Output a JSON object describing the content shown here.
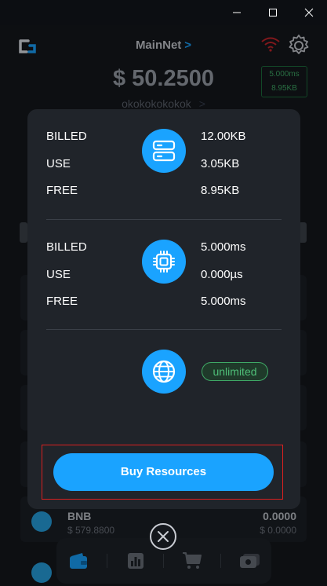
{
  "window": {
    "minimize_glyph": "—",
    "maximize_glyph": "☐",
    "close_glyph": "✕"
  },
  "header": {
    "network": "MainNet",
    "network_chevron": ">",
    "balance": "$ 50.2500",
    "account": "okokokokokok",
    "account_chevron": ">",
    "mini_cpu": "5.000ms",
    "mini_storage": "8.95KB"
  },
  "token_row": {
    "name": "BNB",
    "price": "$ 579.8800",
    "balance": "0.0000",
    "value": "$ 0.0000"
  },
  "modal": {
    "storage": {
      "icon": "server-icon",
      "rows": [
        {
          "label": "BILLED",
          "value": "12.00KB"
        },
        {
          "label": "USE",
          "value": "3.05KB"
        },
        {
          "label": "FREE",
          "value": "8.95KB"
        }
      ]
    },
    "cpu": {
      "icon": "cpu-chip-icon",
      "rows": [
        {
          "label": "BILLED",
          "value": "5.000ms"
        },
        {
          "label": "USE",
          "value": "0.000µs"
        },
        {
          "label": "FREE",
          "value": "5.000ms"
        }
      ]
    },
    "network": {
      "icon": "globe-icon",
      "badge": "unlimited"
    },
    "buy_button": "Buy Resources"
  },
  "nav": {
    "items": [
      "wallet-icon",
      "chart-icon",
      "cart-icon",
      "cash-icon"
    ],
    "active": "wallet-icon"
  },
  "colors": {
    "accent": "#1aa3ff",
    "success": "#3fa966",
    "danger": "#d92020",
    "modal_bg": "#20242a"
  }
}
